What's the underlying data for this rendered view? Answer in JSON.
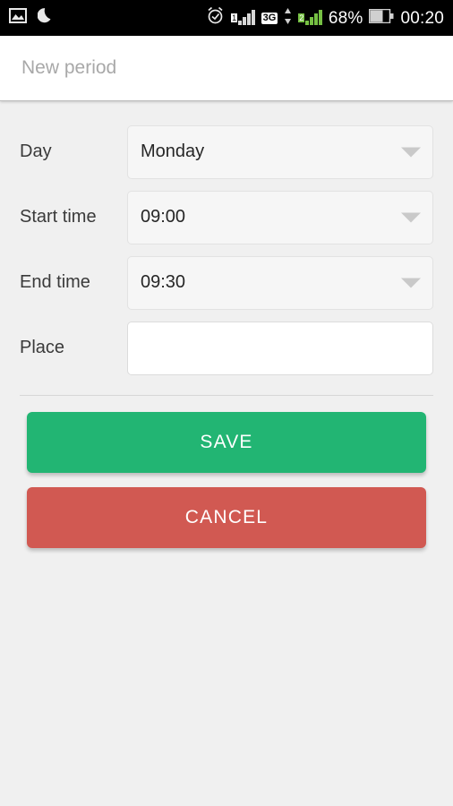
{
  "status_bar": {
    "left_icons": [
      {
        "name": "gallery-icon",
        "label": "image"
      },
      {
        "name": "do-not-disturb-moon-icon",
        "label": "moon"
      }
    ],
    "alarm_icon": "alarm-clock-icon",
    "sim1_badge": "1",
    "network_type": "3G",
    "sim2_badge": "2",
    "battery_percent": "68%",
    "clock": "00:20"
  },
  "header": {
    "title": "New period"
  },
  "form": {
    "fields": [
      {
        "label": "Day",
        "value": "Monday",
        "type": "select"
      },
      {
        "label": "Start time",
        "value": "09:00",
        "type": "select"
      },
      {
        "label": "End time",
        "value": "09:30",
        "type": "select"
      },
      {
        "label": "Place",
        "value": "",
        "placeholder": "",
        "type": "text"
      }
    ]
  },
  "actions": {
    "save_label": "SAVE",
    "cancel_label": "CANCEL"
  },
  "colors": {
    "save_green": "#22b573",
    "cancel_red": "#d15952",
    "page_background": "#f0f0f0",
    "header_background": "#ffffff",
    "status_bar_background": "#000000",
    "title_text": "#a8a8a8"
  }
}
